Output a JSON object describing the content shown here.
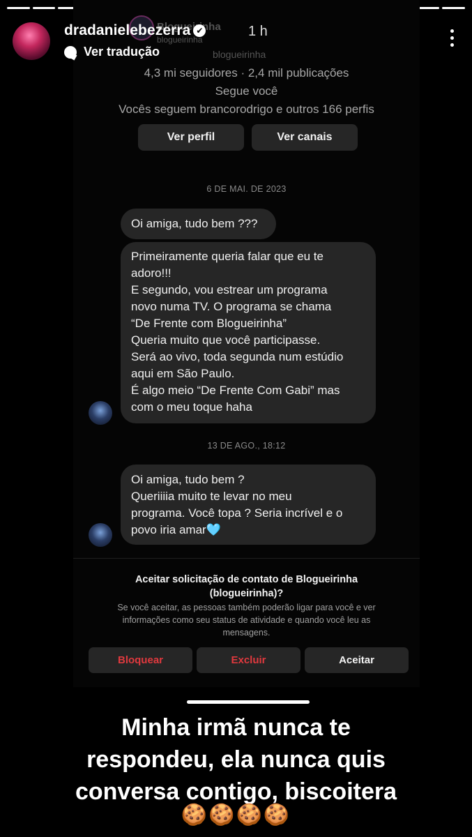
{
  "story": {
    "username": "dradanielebezerra",
    "time": "1 h",
    "translate_label": "Ver tradução",
    "verified_glyph": "✔",
    "progress_segments": 18,
    "progress_done": 18
  },
  "dm": {
    "ghost_name": "Blogueirinha",
    "ghost_handle": "blogueirinha",
    "ghost_handle_2": "blogueirinha",
    "followers_line": "4,3 mi seguidores · 2,4 mil publicações",
    "follows_you": "Segue você",
    "mutuals": "Vocês seguem brancorodrigo e outros 166 perfis",
    "view_profile": "Ver perfil",
    "view_channels": "Ver canais",
    "date_1": "6 DE MAI. DE 2023",
    "date_2": "13 DE AGO., 18:12",
    "msg_1": "Oi amiga, tudo bem ???",
    "msg_2": [
      "Primeiramente queria falar que eu te",
      "adoro!!!",
      "E segundo, vou estrear um programa",
      "novo numa TV. O programa se chama",
      "“De Frente com Blogueirinha”",
      "Queria muito que você participasse.",
      "Será ao vivo, toda segunda num estúdio",
      "aqui em São Paulo.",
      "É algo meio “De Frente Com Gabi” mas",
      "com o meu toque haha"
    ],
    "msg_3": [
      "Oi amiga, tudo bem ?",
      "Queriiiia muito te levar no meu",
      "programa. Você topa ? Seria incrível e o",
      "povo iria amar🩵"
    ],
    "request_title_1": "Aceitar solicitação de contato de Blogueirinha",
    "request_title_2": "(blogueirinha)?",
    "request_note_1": "Se você aceitar, as pessoas também poderão ligar para você e ver",
    "request_note_2": "informações como seu status de atividade e quando você leu as",
    "request_note_3": "mensagens.",
    "block_label": "Bloquear",
    "delete_label": "Excluir",
    "accept_label": "Aceitar",
    "danger_color": "#e0393e"
  },
  "caption": {
    "line_1": "Minha irmã nunca te",
    "line_2": "respondeu, ela nunca quis",
    "line_3": "conversa contigo, biscoitera",
    "emojis": "🍪🍪🍪🍪"
  }
}
